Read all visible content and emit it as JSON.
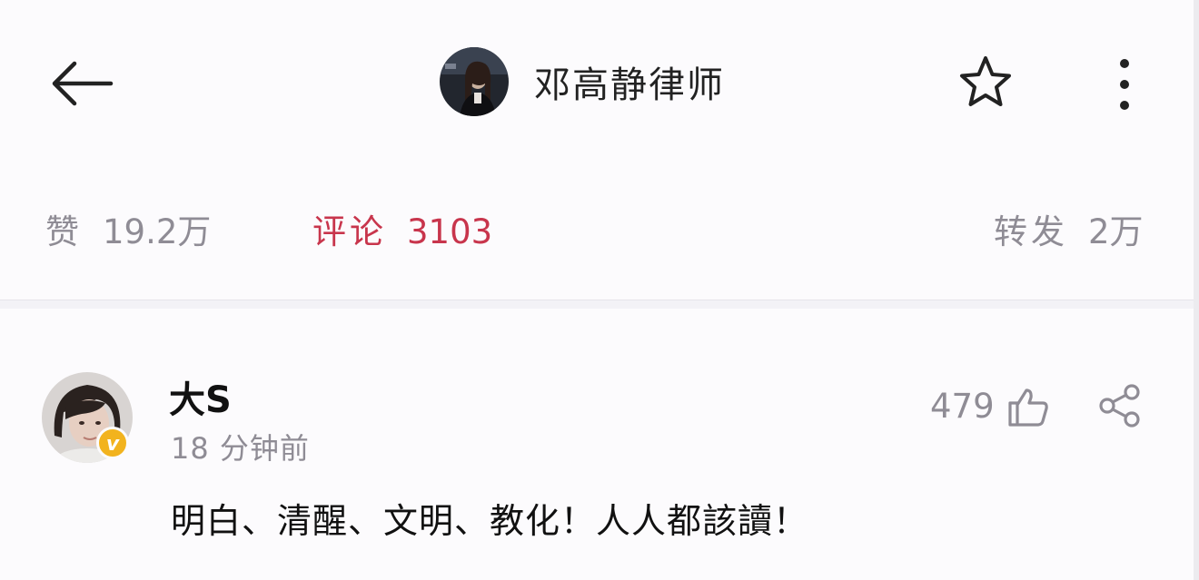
{
  "header": {
    "back_icon": "arrow-left-icon",
    "title": "邓高静律师",
    "star_icon": "star-outline-icon",
    "more_icon": "more-vertical-icon"
  },
  "stats": {
    "likes_label": "赞",
    "likes_value": "19.2万",
    "comments_label": "评论",
    "comments_value": "3103",
    "reposts_label": "转发",
    "reposts_value": "2万",
    "active_color": "#c8354c"
  },
  "comment": {
    "user_name": "大S",
    "time": "18 分钟前",
    "likes": "479",
    "like_icon": "thumbs-up-icon",
    "share_icon": "share-icon",
    "verified_badge": "v",
    "badge_color": "#f2b31e",
    "text": "明白、清醒、文明、教化！人人都該讀！"
  }
}
